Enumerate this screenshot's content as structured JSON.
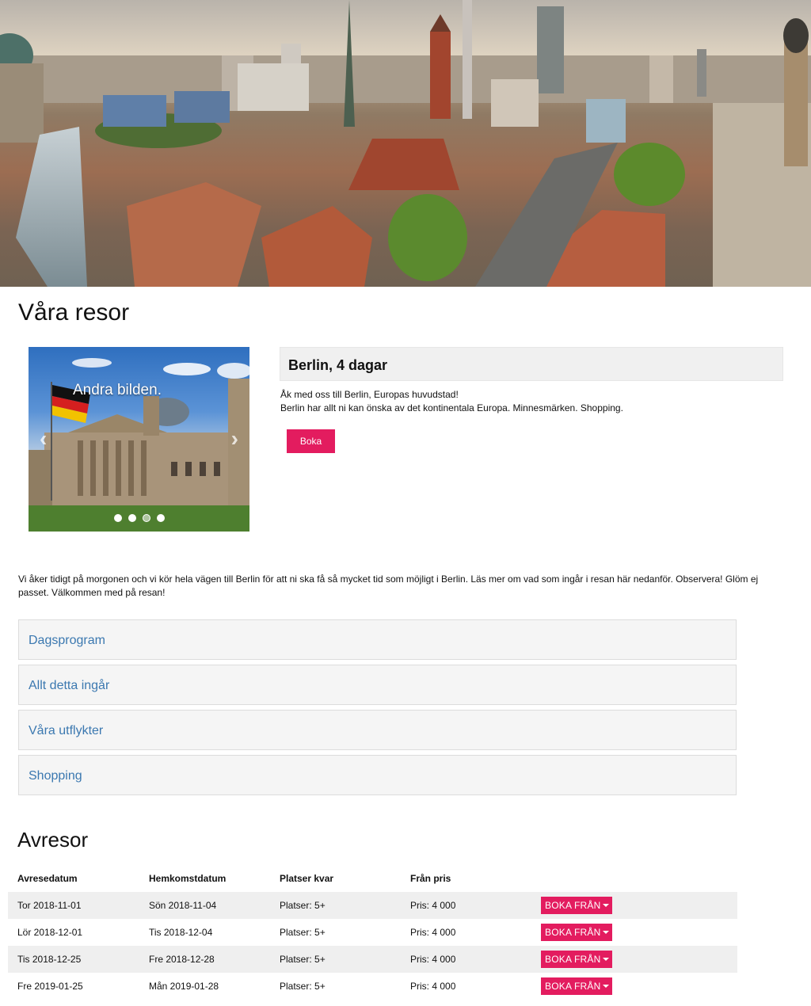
{
  "page": {
    "title": "Våra resor"
  },
  "carousel": {
    "caption": "Andra bilden.",
    "slide_count": 4,
    "active_slide": 2
  },
  "trip": {
    "heading": "Berlin, 4 dagar",
    "line1": "Åk med oss till Berlin, Europas huvudstad!",
    "line2": "Berlin har allt ni kan önska av det kontinentala Europa. Minnesmärken. Shopping.",
    "book_label": "Boka"
  },
  "intro": "Vi åker tidigt på morgonen och vi kör hela vägen till Berlin för att ni ska få så mycket tid som möjligt i Berlin. Läs mer om vad som ingår i resan här nedanför. Observera! Glöm ej passet. Välkommen med på resan!",
  "accordion": [
    {
      "label": "Dagsprogram"
    },
    {
      "label": "Allt detta ingår"
    },
    {
      "label": "Våra utflykter"
    },
    {
      "label": "Shopping"
    }
  ],
  "departures": {
    "title": "Avresor",
    "headers": [
      "Avresedatum",
      "Hemkomstdatum",
      "Platser kvar",
      "Från pris"
    ],
    "book_label": "BOKA FRÅN",
    "rows": [
      {
        "depart": "Tor 2018-11-01",
        "return": "Sön 2018-11-04",
        "seats": "Platser: 5+",
        "price": "Pris: 4 000"
      },
      {
        "depart": "Lör 2018-12-01",
        "return": "Tis 2018-12-04",
        "seats": "Platser: 5+",
        "price": "Pris: 4 000"
      },
      {
        "depart": "Tis 2018-12-25",
        "return": "Fre 2018-12-28",
        "seats": "Platser: 5+",
        "price": "Pris: 4 000"
      },
      {
        "depart": "Fre 2019-01-25",
        "return": "Mån 2019-01-28",
        "seats": "Platser: 5+",
        "price": "Pris: 4 000"
      }
    ]
  },
  "colors": {
    "accent": "#e31c5f",
    "link": "#3b78b0",
    "panel": "#f5f5f5"
  }
}
